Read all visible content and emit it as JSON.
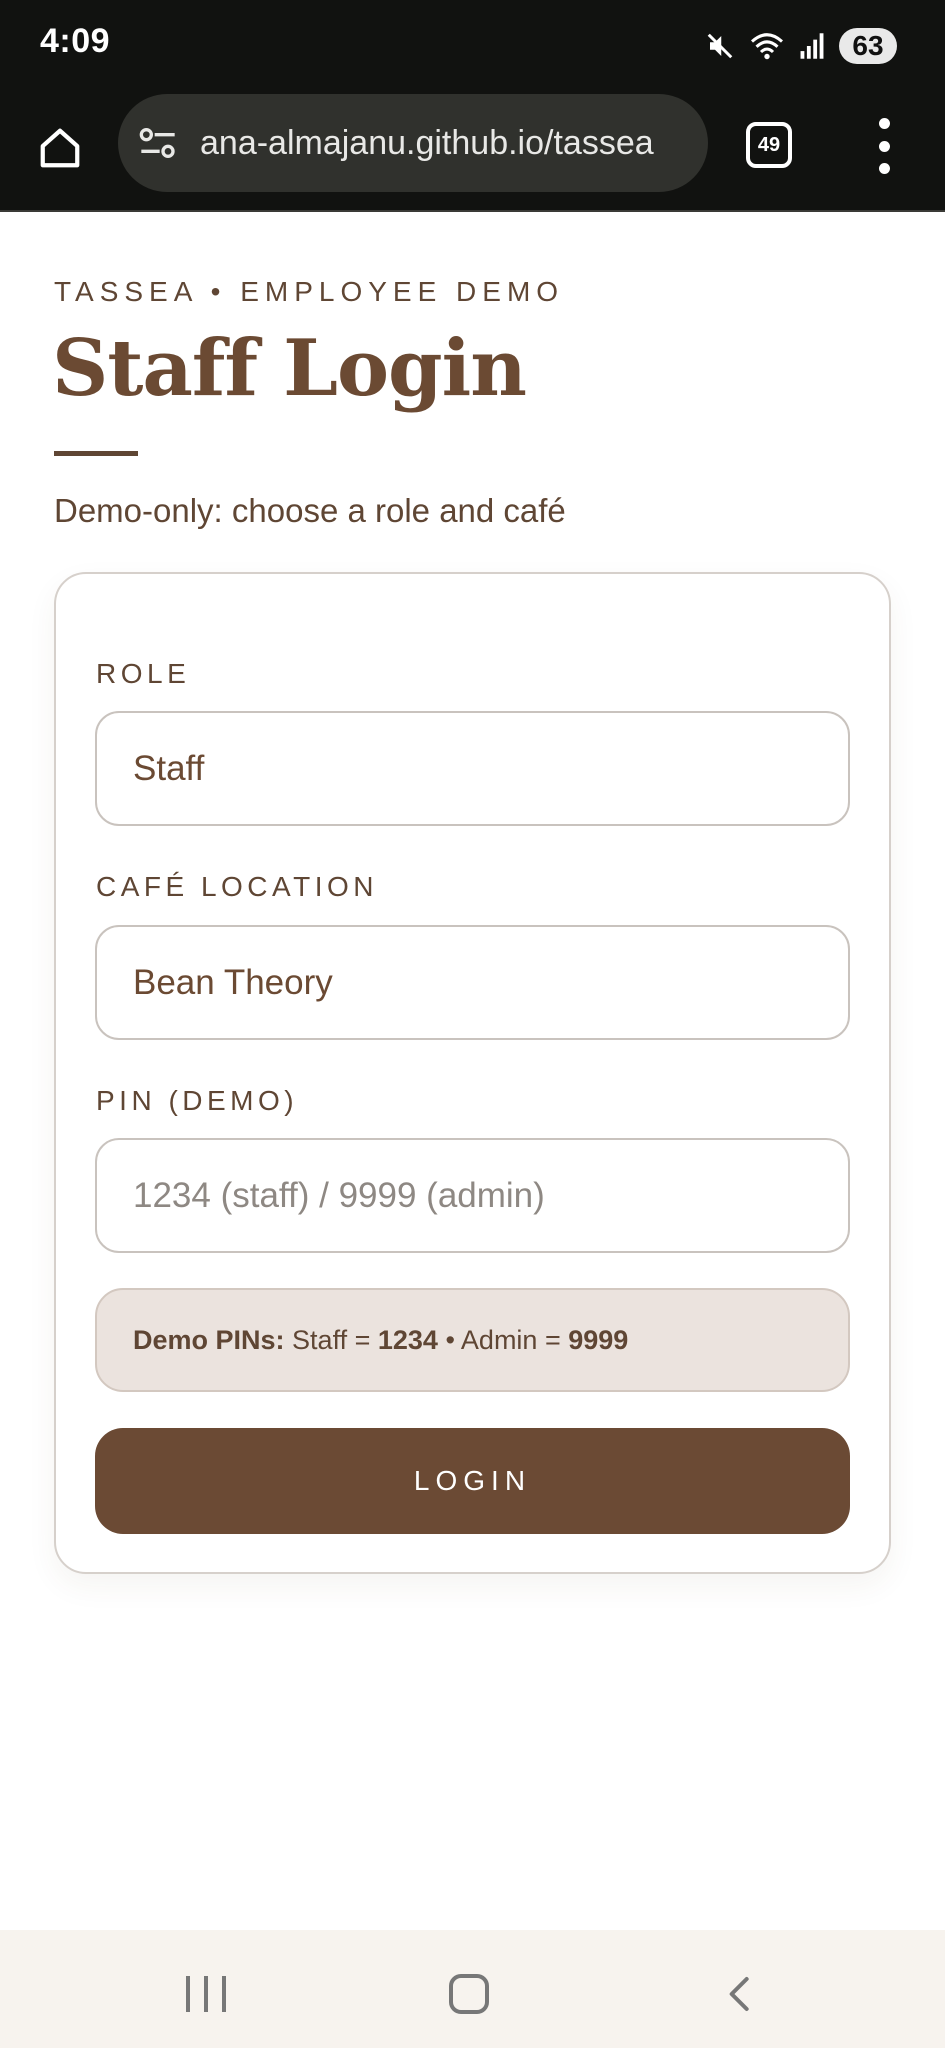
{
  "status_bar": {
    "time": "4:09",
    "battery": "63",
    "icons": [
      "mute-icon",
      "wifi-icon",
      "signal-icon",
      "battery-icon"
    ]
  },
  "browser": {
    "url": "ana-almajanu.github.io/tassea",
    "tab_count": "49",
    "icons": [
      "home-icon",
      "site-settings-icon",
      "tabs-icon",
      "more-vert-icon"
    ]
  },
  "page": {
    "eyebrow": "TASSEA • EMPLOYEE DEMO",
    "title": "Staff Login",
    "subtitle": "Demo-only: choose a role and café"
  },
  "form": {
    "role_label": "ROLE",
    "role_value": "Staff",
    "location_label": "CAFÉ LOCATION",
    "location_value": "Bean Theory",
    "pin_label": "PIN (DEMO)",
    "pin_placeholder": "1234 (staff) / 9999 (admin)",
    "hint": {
      "prefix": "Demo PINs:",
      "staff_text": " Staff = ",
      "staff_pin": "1234",
      "admin_text": " • Admin = ",
      "admin_pin": "9999"
    },
    "login_label": "LOGIN"
  },
  "colors": {
    "brand_brown": "#6b4a34",
    "hint_bg": "#ebe3de",
    "system_bar": "#111210",
    "nav_bar": "#f7f3ee"
  }
}
